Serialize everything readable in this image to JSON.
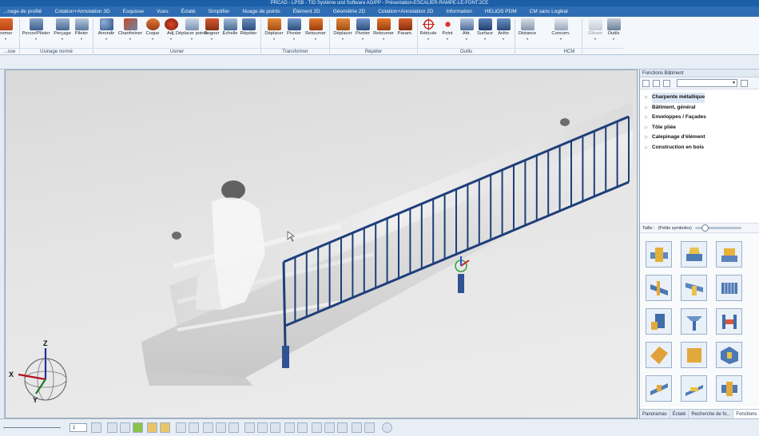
{
  "window": {
    "title": "PRCAD - LPSB - TID Système und Software AG/PP - Présentation-ESCALIER-RAMPE-LE-FONT.2CE"
  },
  "ribbon_tabs": [
    "...nage de profilé",
    "Cotation+Annotation 3D",
    "Esquisse",
    "Vues",
    "Éclaté",
    "Simplifier",
    "Nuage de points",
    "Élément 2D",
    "Géométrie 2D",
    "Cotation+Annotation 2D",
    "Information",
    "HELiOS PDM",
    "CM sans Logikal"
  ],
  "ribbon": {
    "tools": [
      {
        "label": "former",
        "arrow": "▾"
      },
      {
        "label": "Percer/Pileter",
        "arrow": "▾"
      },
      {
        "label": "Perçage",
        "arrow": "▾"
      },
      {
        "label": "Pileter",
        "arrow": "▾"
      },
      {
        "label": "Arrondir",
        "arrow": "▾"
      },
      {
        "label": "Chanfreiner",
        "arrow": "▾"
      },
      {
        "label": "Coque",
        "arrow": "▾"
      },
      {
        "label": "Adj.",
        "arrow": "▾"
      },
      {
        "label": "Déplacer points",
        "arrow": "▾"
      },
      {
        "label": "Rogner",
        "arrow": "▾"
      },
      {
        "label": "Échelle",
        "arrow": ""
      },
      {
        "label": "Répéter",
        "arrow": ""
      },
      {
        "label": "Déplacer",
        "arrow": "▾"
      },
      {
        "label": "Pivoter",
        "arrow": "▾"
      },
      {
        "label": "Retourner",
        "arrow": "▾"
      },
      {
        "label": "Déplacer",
        "arrow": "▾"
      },
      {
        "label": "Pivoter",
        "arrow": "▾"
      },
      {
        "label": "Retourner",
        "arrow": "▾"
      },
      {
        "label": "Param.",
        "arrow": ""
      },
      {
        "label": "Réticule",
        "arrow": "▾"
      },
      {
        "label": "Point",
        "arrow": "▾"
      },
      {
        "label": "Attr.",
        "arrow": "▾"
      },
      {
        "label": "Surface",
        "arrow": "▾"
      },
      {
        "label": "Arête",
        "arrow": "▾"
      },
      {
        "label": "Distance",
        "arrow": "▾"
      },
      {
        "label": "Concom.",
        "arrow": "▾"
      },
      {
        "label": "Glisser",
        "arrow": "▾"
      },
      {
        "label": "Outils",
        "arrow": "▾"
      }
    ],
    "groups": [
      "...ose",
      "Usinage normé",
      "Usiner",
      "Transformer",
      "Répéter",
      "Outils",
      "HCM"
    ]
  },
  "viewport": {
    "axis_labels": {
      "z": "Z",
      "x": "X",
      "y": "Y"
    }
  },
  "panel": {
    "title": "Fonctions Bâtiment",
    "tree": [
      {
        "label": "Charpente métallique",
        "selected": true
      },
      {
        "label": "Bâtiment, général",
        "selected": false
      },
      {
        "label": "Enveloppes / Façades",
        "selected": false
      },
      {
        "label": "Tôle pliée",
        "selected": false
      },
      {
        "label": "Calepinage d'élément",
        "selected": false
      },
      {
        "label": "Construction en bois",
        "selected": false
      }
    ],
    "size_label": "Taille :",
    "size_value": "(Petits symboles)",
    "gallery_icons": [
      "connection-plate-icon",
      "beam-joint-icon",
      "bracket-icon",
      "stair-stringer-icon",
      "beam-splice-icon",
      "grating-icon",
      "column-base-icon",
      "beam-section-icon",
      "frame-bracing-icon",
      "anchor-plate-icon",
      "base-plate-icon",
      "node-connection-icon",
      "purlin-icon",
      "rail-profile-icon",
      "bolt-group-icon"
    ],
    "tabs": [
      "Panoramas",
      "Éclaté",
      "Recherche de fo...",
      "Fonctions"
    ],
    "active_tab": 3
  },
  "statusbar": {
    "number_value": "1"
  },
  "colors": {
    "ribbon_tab_bg": "#2e6db3",
    "railing_blue": "#1f3f7a",
    "accent_orange": "#d97a28"
  }
}
